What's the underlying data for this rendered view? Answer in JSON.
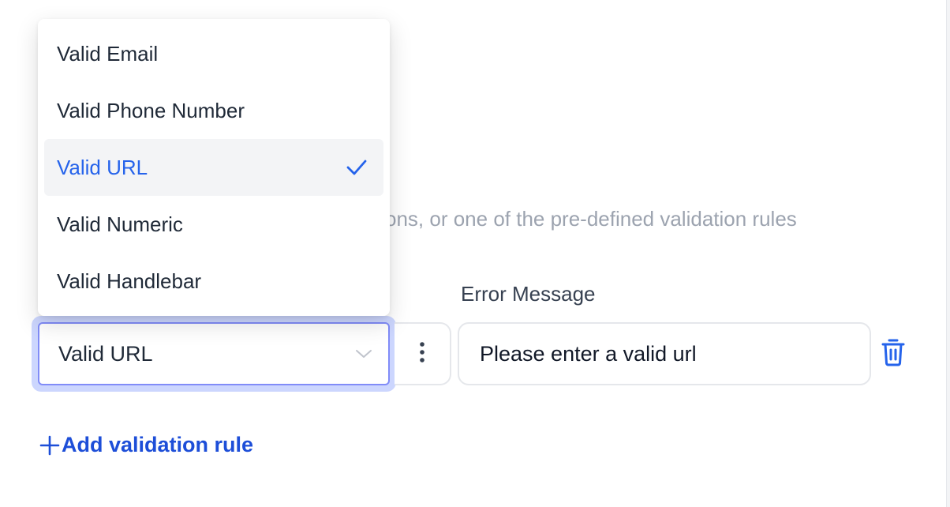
{
  "help_text": "ons, or one of the pre-defined validation rules",
  "error_message_label": "Error Message",
  "rule_select": {
    "value": "Valid URL",
    "options": [
      {
        "label": "Valid Email",
        "selected": false
      },
      {
        "label": "Valid Phone Number",
        "selected": false
      },
      {
        "label": "Valid URL",
        "selected": true
      },
      {
        "label": "Valid Numeric",
        "selected": false
      },
      {
        "label": "Valid Handlebar",
        "selected": false
      }
    ]
  },
  "error_input": {
    "value": "Please enter a valid url"
  },
  "add_rule_label": "Add validation rule",
  "icons": {
    "chevron": "chevron-down-icon",
    "more": "vertical-ellipsis-icon",
    "delete": "trash-icon",
    "check": "check-icon",
    "plus": "plus-icon"
  },
  "colors": {
    "accent": "#2563eb",
    "link": "#1d4ed8",
    "focus_ring": "#c7d2fe",
    "muted_text": "#9ca3af",
    "selected_bg": "#f3f4f6"
  }
}
